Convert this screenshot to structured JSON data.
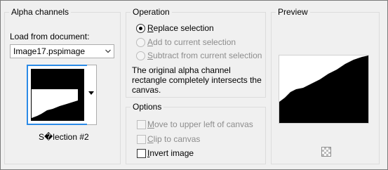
{
  "alpha_channels": {
    "title": "Alpha channels",
    "load_from_label": "Load from document:",
    "document_value": "Image17.pspimage",
    "channel_name": "S�lection #2"
  },
  "operation": {
    "title": "Operation",
    "options": [
      {
        "label": "Replace selection",
        "selected": true,
        "enabled": true
      },
      {
        "label": "Add to current selection",
        "selected": false,
        "enabled": false
      },
      {
        "label": "Subtract from current selection",
        "selected": false,
        "enabled": false
      }
    ],
    "info_line1": "The original alpha channel",
    "info_line2": "rectangle completely intersects the",
    "info_line3": "canvas."
  },
  "options": {
    "title": "Options",
    "items": [
      {
        "label": "Move to upper left of canvas",
        "checked": false,
        "enabled": false
      },
      {
        "label": "Clip to canvas",
        "checked": false,
        "enabled": false
      },
      {
        "label": "Invert image",
        "checked": false,
        "enabled": true
      }
    ]
  },
  "preview": {
    "title": "Preview"
  },
  "colors": {
    "thumb_border": "#2b8ae6",
    "disabled_text": "#8d8d8d"
  }
}
